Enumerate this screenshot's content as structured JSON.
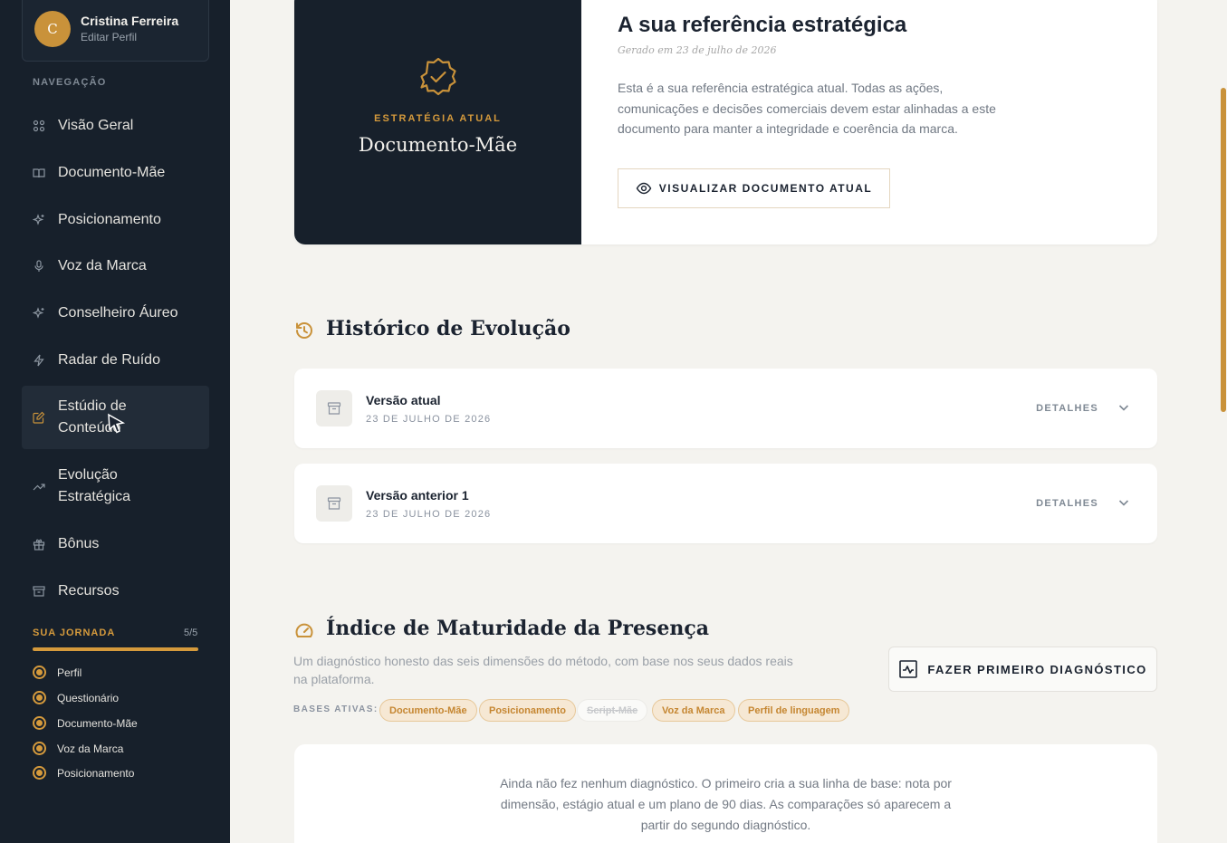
{
  "profile": {
    "initial": "C",
    "name": "Cristina Ferreira",
    "edit_label": "Editar Perfil"
  },
  "nav": {
    "heading": "NAVEGAÇÃO",
    "items": [
      {
        "label": "Visão Geral",
        "icon": "grid-icon"
      },
      {
        "label": "Documento-Mãe",
        "icon": "book-icon"
      },
      {
        "label": "Posicionamento",
        "icon": "sparkle-icon"
      },
      {
        "label": "Voz da Marca",
        "icon": "microphone-icon"
      },
      {
        "label": "Conselheiro Áureo",
        "icon": "sparkle-icon"
      },
      {
        "label": "Radar de Ruído",
        "icon": "lightning-icon"
      },
      {
        "label": "Estúdio de Conteúdo",
        "icon": "edit-icon",
        "active": true
      },
      {
        "label": "Evolução Estratégica",
        "icon": "trend-up-icon"
      },
      {
        "label": "Bônus",
        "icon": "gift-icon"
      },
      {
        "label": "Recursos",
        "icon": "archive-icon"
      }
    ]
  },
  "journey": {
    "heading": "SUA JORNADA",
    "count": "5/5",
    "progress": 1.0,
    "items": [
      "Perfil",
      "Questionário",
      "Documento-Mãe",
      "Voz da Marca",
      "Posicionamento"
    ]
  },
  "hero": {
    "kicker": "ESTRATÉGIA ATUAL",
    "doc_title": "Documento-Mãe",
    "title": "A sua referência estratégica",
    "generated": "Gerado em 23 de julho de 2026",
    "description": "Esta é a sua referência estratégica atual. Todas as ações, comunicações e decisões comerciais devem estar alinhadas a este documento para manter a integridade e coerência da marca.",
    "button_label": "VISUALIZAR DOCUMENTO ATUAL"
  },
  "history": {
    "title": "Histórico de Evolução",
    "versions": [
      {
        "title": "Versão atual",
        "date": "23 DE JULHO DE 2026",
        "details_label": "DETALHES"
      },
      {
        "title": "Versão anterior 1",
        "date": "23 DE JULHO DE 2026",
        "details_label": "DETALHES"
      }
    ]
  },
  "maturity": {
    "title": "Índice de Maturidade da Presença",
    "description": "Um diagnóstico honesto das seis dimensões do método, com base nos seus dados reais na plataforma.",
    "bases_label": "BASES ATIVAS:",
    "bases": [
      {
        "label": "Documento-Mãe",
        "active": true
      },
      {
        "label": "Posicionamento",
        "active": true
      },
      {
        "label": "Script-Mãe",
        "active": false
      },
      {
        "label": "Voz da Marca",
        "active": true
      },
      {
        "label": "Perfil de linguagem",
        "active": true
      }
    ],
    "button_label": "FAZER PRIMEIRO DIAGNÓSTICO",
    "empty_text": "Ainda não fez nenhum diagnóstico. O primeiro cria a sua linha de base: nota por dimensão, estágio atual e um plano de 90 dias. As comparações só aparecem a partir do segundo diagnóstico."
  },
  "colors": {
    "accent": "#c9923a",
    "sidebar_bg": "#17202b",
    "page_bg": "#f4f3ef"
  }
}
